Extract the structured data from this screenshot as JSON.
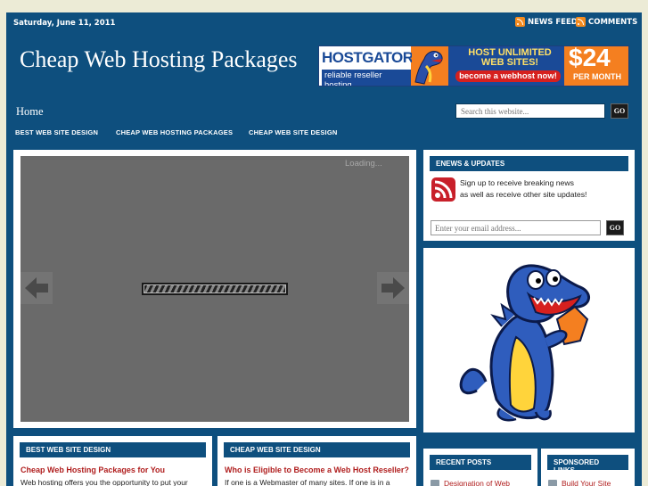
{
  "topbar": {
    "date": "Saturday, June 11, 2011",
    "news_feed": "NEWS FEED",
    "comments": "COMMENTS"
  },
  "header": {
    "site_title": "Cheap Web Hosting Packages",
    "banner": {
      "brand": "HOSTGATOR",
      "sub": "reliable reseller hosting",
      "headline": "HOST UNLIMITED WEB SITES!",
      "cta": "become a webhost now!",
      "price": "$24",
      "period": "PER MONTH"
    }
  },
  "nav": {
    "home": "Home",
    "search_placeholder": "Search this website...",
    "search_go": "GO",
    "subnav": [
      "BEST WEB SITE DESIGN",
      "CHEAP WEB HOSTING PACKAGES",
      "CHEAP WEB SITE DESIGN"
    ]
  },
  "slider": {
    "loading": "Loading..."
  },
  "enews": {
    "title": "ENEWS & UPDATES",
    "line1": "Sign up to receive breaking news",
    "line2": "as well as receive other site updates!",
    "email_placeholder": "Enter your email address...",
    "go": "GO"
  },
  "bottom": {
    "col1": {
      "title": "BEST WEB SITE DESIGN",
      "post_title": "Cheap Web Hosting Packages for You",
      "excerpt": "Web hosting offers you the opportunity to put your"
    },
    "col2": {
      "title": "CHEAP WEB SITE DESIGN",
      "post_title": "Who is Eligible to Become a Web Host Reseller?",
      "excerpt": "If one is a Webmaster of many sites. If one is in a"
    },
    "recent": {
      "title": "RECENT POSTS",
      "link": "Designation of Web"
    },
    "sponsored": {
      "title": "SPONSORED LINKS",
      "link": "Build Your Site"
    }
  },
  "colors": {
    "page_bg": "#ecebd6",
    "wrap_bg": "#0e4f7e",
    "link_red": "#b01e1e",
    "rss_orange": "#f48b1f"
  },
  "icons": {
    "rss": "rss-icon",
    "prev": "arrow-left-icon",
    "next": "arrow-right-icon",
    "mascot": "hostgator-gator-mascot"
  }
}
